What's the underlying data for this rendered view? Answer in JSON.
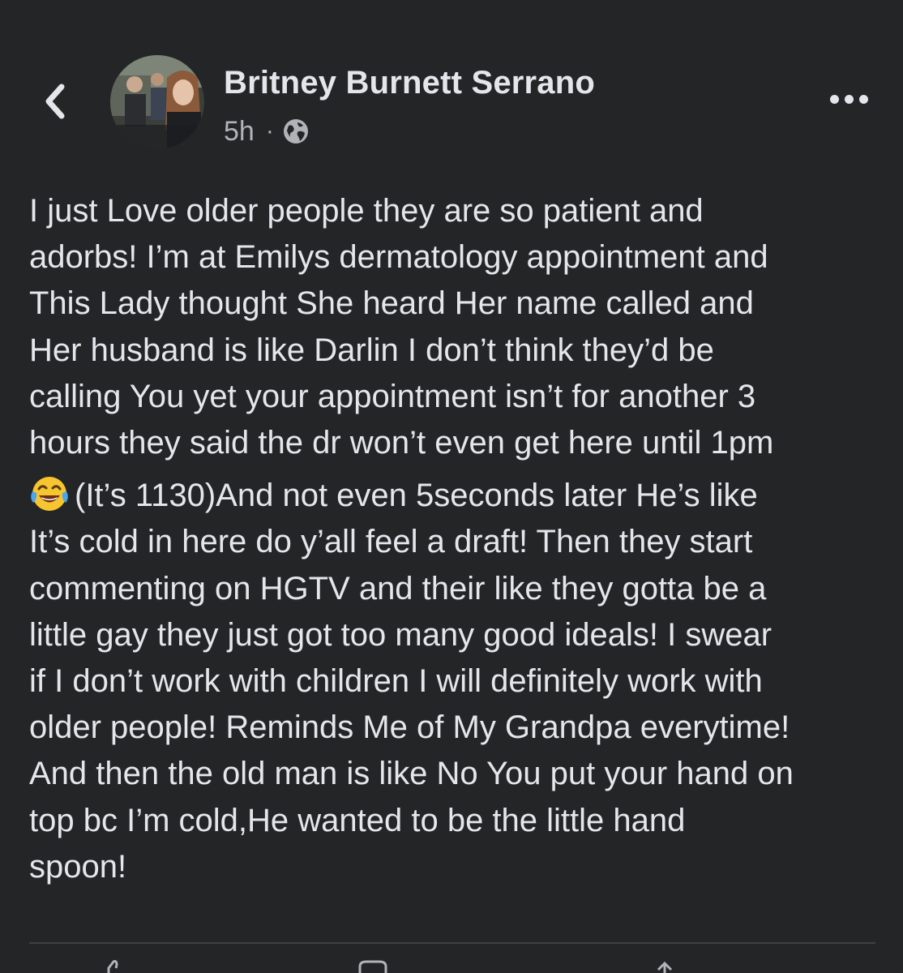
{
  "header": {
    "back_icon": "chevron-left-icon",
    "author_name": "Britney Burnett Serrano",
    "time_ago": "5h",
    "separator": "·",
    "privacy_icon": "globe-icon",
    "more_icon": "more-horizontal-icon"
  },
  "post": {
    "lines": [
      "I just Love older people they are so patient and",
      "adorbs! I’m at Emilys dermatology appointment and",
      "This Lady thought She heard Her name called and",
      "Her husband is like Darlin I don’t think they’d be",
      "calling You yet your appointment isn’t for another 3",
      "hours they said the dr won’t even get here until 1pm",
      "(It’s 1130)And not even 5seconds later He’s like",
      "It’s cold in here do y’all feel a draft!  Then they start",
      "commenting on HGTV and their like they gotta be a",
      "little gay they just got too many good ideals! I swear",
      "if I don’t work with children I will definitely work with",
      "older people! Reminds Me of My Grandpa everytime!",
      "And then the old man is like No You put your hand on",
      "top bc I’m cold,He wanted to be the little hand",
      "spoon!"
    ],
    "emoji_icon": "face-with-tears-of-joy-icon"
  },
  "actions": {
    "like_icon": "like-icon",
    "comment_icon": "comment-icon",
    "share_icon": "share-icon"
  },
  "colors": {
    "background": "#242526",
    "primary_text": "#e4e6eb",
    "secondary_text": "#b0b3b8",
    "divider": "#3e4042"
  }
}
